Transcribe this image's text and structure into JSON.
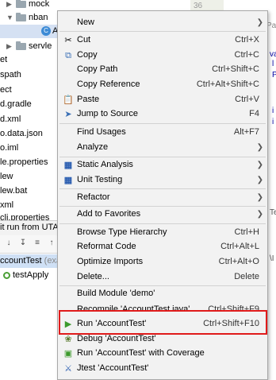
{
  "project_tree": {
    "rows": [
      {
        "label": "mock",
        "type": "folder"
      },
      {
        "label": "nban",
        "type": "folder"
      },
      {
        "label": "A",
        "type": "class"
      },
      {
        "label": "servle",
        "type": "folder"
      }
    ],
    "left_items": [
      "et",
      "spath",
      "ect",
      "d.gradle",
      "d.xml",
      "o.data.json",
      "o.iml",
      "le.properties",
      "lew",
      "lew.bat",
      "xml",
      "cli.properties"
    ]
  },
  "editor": {
    "gutter_number": "36",
    "fragments": [
      "Pa",
      "va",
      "l",
      "P",
      "i",
      "i",
      "Te",
      "\\I"
    ]
  },
  "run_panel": {
    "title": "it run from UTA",
    "class_row": "ccountTest",
    "class_row_hint": "(exa",
    "method_row": "testApply"
  },
  "menu": {
    "items": [
      {
        "label": "New",
        "shortcut": "",
        "submenu": true,
        "icon": ""
      },
      {
        "label": "Cut",
        "shortcut": "Ctrl+X",
        "submenu": false,
        "icon": "scissors-icon"
      },
      {
        "label": "Copy",
        "shortcut": "Ctrl+C",
        "submenu": false,
        "icon": "copy-icon"
      },
      {
        "label": "Copy Path",
        "shortcut": "Ctrl+Shift+C",
        "submenu": false,
        "icon": ""
      },
      {
        "label": "Copy Reference",
        "shortcut": "Ctrl+Alt+Shift+C",
        "submenu": false,
        "icon": ""
      },
      {
        "label": "Paste",
        "shortcut": "Ctrl+V",
        "submenu": false,
        "icon": "paste-icon"
      },
      {
        "label": "Jump to Source",
        "shortcut": "F4",
        "submenu": false,
        "icon": "jump-icon"
      },
      {
        "label": "Find Usages",
        "shortcut": "Alt+F7",
        "submenu": false,
        "icon": ""
      },
      {
        "label": "Analyze",
        "shortcut": "",
        "submenu": true,
        "icon": ""
      },
      {
        "label": "Static Analysis",
        "shortcut": "",
        "submenu": true,
        "icon": "static-analysis-icon"
      },
      {
        "label": "Unit Testing",
        "shortcut": "",
        "submenu": true,
        "icon": "unit-testing-icon"
      },
      {
        "label": "Refactor",
        "shortcut": "",
        "submenu": true,
        "icon": ""
      },
      {
        "label": "Add to Favorites",
        "shortcut": "",
        "submenu": true,
        "icon": ""
      },
      {
        "label": "Browse Type Hierarchy",
        "shortcut": "Ctrl+H",
        "submenu": false,
        "icon": ""
      },
      {
        "label": "Reformat Code",
        "shortcut": "Ctrl+Alt+L",
        "submenu": false,
        "icon": ""
      },
      {
        "label": "Optimize Imports",
        "shortcut": "Ctrl+Alt+O",
        "submenu": false,
        "icon": ""
      },
      {
        "label": "Delete...",
        "shortcut": "Delete",
        "submenu": false,
        "icon": ""
      },
      {
        "label": "Build Module 'demo'",
        "shortcut": "",
        "submenu": false,
        "icon": ""
      },
      {
        "label": "Recompile 'AccountTest.java'",
        "shortcut": "Ctrl+Shift+F9",
        "submenu": false,
        "icon": ""
      },
      {
        "label": "Run 'AccountTest'",
        "shortcut": "Ctrl+Shift+F10",
        "submenu": false,
        "icon": "run-icon"
      },
      {
        "label": "Debug 'AccountTest'",
        "shortcut": "",
        "submenu": false,
        "icon": "debug-icon"
      },
      {
        "label": "Run 'AccountTest' with Coverage",
        "shortcut": "",
        "submenu": false,
        "icon": "coverage-icon"
      },
      {
        "label": "Jtest 'AccountTest'",
        "shortcut": "",
        "submenu": false,
        "icon": "jtest-icon"
      }
    ]
  },
  "colors": {
    "highlight_border": "#e01b1b",
    "menu_background": "#f2f2f2",
    "run_green": "#3c9a2c"
  }
}
